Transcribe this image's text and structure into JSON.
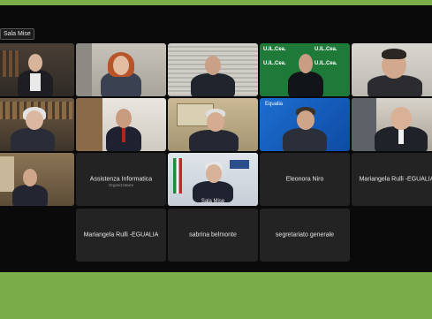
{
  "window": {
    "room_label": "Sala Mise"
  },
  "colors": {
    "frame_background": "#7aac4a",
    "tile_background": "#232323",
    "active_speaker_outline": "#c9d64a"
  },
  "participants": {
    "assistenza": {
      "name": "Assistenza Informatica",
      "role": "Organizzatore"
    },
    "eleonora": {
      "name": "Eleonora Niro"
    },
    "mariangela_1": {
      "name": "Mariangela Rulli -EGUALIA"
    },
    "mariangela_2": {
      "name": "Mariangela Rulli -EGUALIA"
    },
    "sabrina": {
      "name": "sabrina belmonte"
    },
    "segretariato": {
      "name": "segretariato generale"
    },
    "sala_mise": {
      "name": "Sala Mise"
    }
  },
  "overlays": {
    "uil_banner": "U.IL.Cea.",
    "equalia_logo": "Equalia"
  }
}
